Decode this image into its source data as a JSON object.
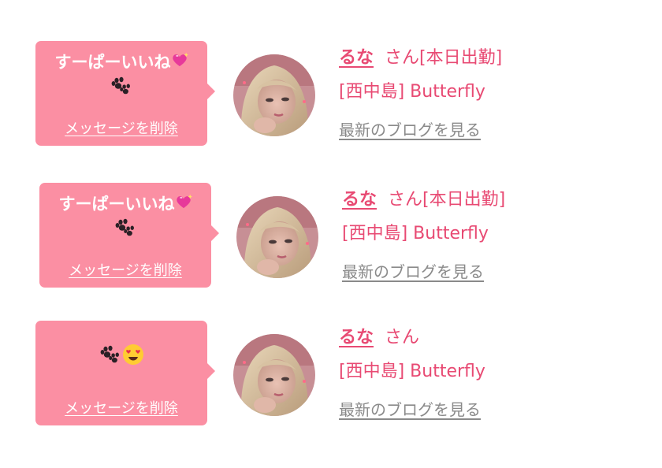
{
  "messages": [
    {
      "message": "すーぱーいいね",
      "delete_label": "メッセージを削除",
      "name": "るな",
      "honorific": "さん[本日出勤]",
      "shop": "[西中島] Butterfly",
      "blog_label": "最新のブログを見る"
    },
    {
      "message": "すーぱーいいね",
      "delete_label": "メッセージを削除",
      "name": "るな",
      "honorific": "さん[本日出勤]",
      "shop": "[西中島] Butterfly",
      "blog_label": "最新のブログを見る"
    },
    {
      "message": "",
      "delete_label": "メッセージを削除",
      "name": "るな",
      "honorific": "さん",
      "shop": "[西中島] Butterfly",
      "blog_label": "最新のブログを見る"
    }
  ],
  "icons": {
    "sparkling_heart": "sparkling-heart-emoji",
    "paw_prints": "paw-prints-emoji",
    "heart_eyes": "heart-eyes-emoji"
  },
  "colors": {
    "bubble": "#fb8fa3",
    "accent": "#e84a73",
    "link_gray": "#8a8a8a"
  }
}
